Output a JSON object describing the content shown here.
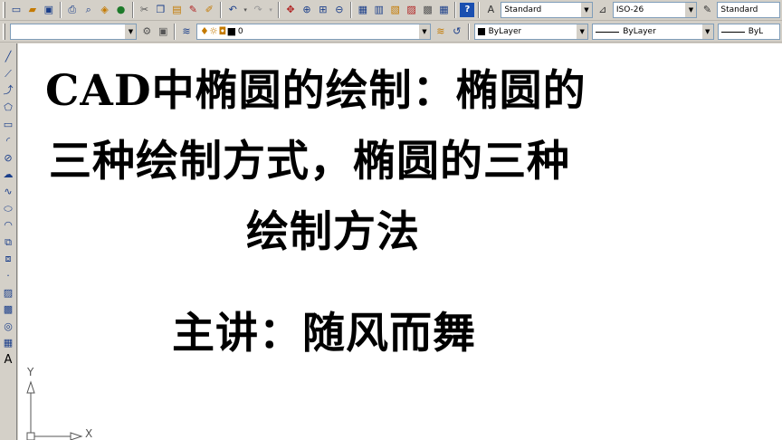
{
  "toolbar": {
    "text_style_value": "Standard",
    "dim_style_value": "ISO-26",
    "table_style_value": "Standard",
    "workspace_value": "",
    "layer_value": "0",
    "color_value": "ByLayer",
    "linetype_value": "ByLayer",
    "lineweight_value": "ByL"
  },
  "canvas": {
    "line1": "CAD中椭圆的绘制：椭圆的",
    "line2": "三种绘制方式，椭圆的三种",
    "line3": "绘制方法",
    "line4": "主讲：随风而舞"
  },
  "ucs": {
    "y_label": "Y",
    "x_label": "X"
  },
  "draw_toolbar": {
    "text_tool_label": "A"
  },
  "colors": {
    "ui_background": "#d4d0c8",
    "canvas_background": "#ffffff",
    "text": "#000000"
  }
}
